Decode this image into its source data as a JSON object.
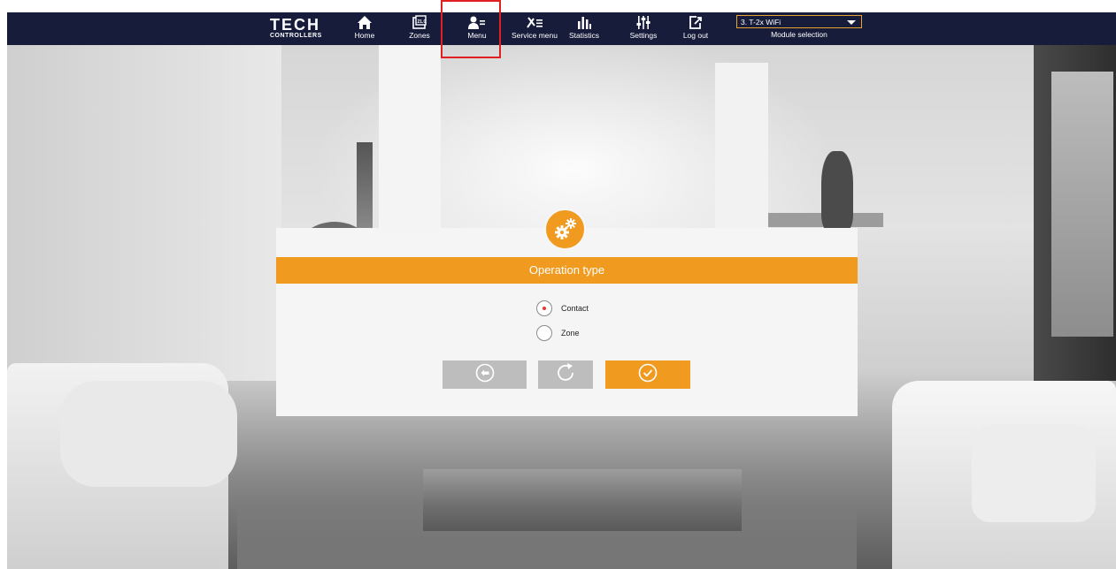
{
  "header": {
    "logo": {
      "line1": "TECH",
      "line2": "CONTROLLERS"
    },
    "nav": [
      {
        "label": "Home",
        "icon": "home-icon"
      },
      {
        "label": "Zones",
        "icon": "zones-icon"
      },
      {
        "label": "Menu",
        "icon": "menu-user-icon"
      },
      {
        "label": "Service menu",
        "icon": "service-tools-icon"
      },
      {
        "label": "Statistics",
        "icon": "statistics-bars-icon"
      },
      {
        "label": "Settings",
        "icon": "settings-sliders-icon"
      },
      {
        "label": "Log out",
        "icon": "logout-icon"
      }
    ],
    "module_select": {
      "value": "3. T-2x WiFi",
      "caption": "Module selection"
    }
  },
  "dialog": {
    "title": "Operation type",
    "icon": "gears-icon",
    "options": [
      {
        "label": "Contact",
        "selected": true
      },
      {
        "label": "Zone",
        "selected": false
      }
    ],
    "buttons": [
      {
        "name": "back",
        "icon": "back-arrow-icon"
      },
      {
        "name": "refresh",
        "icon": "refresh-icon"
      },
      {
        "name": "confirm",
        "icon": "checkmark-icon"
      }
    ]
  },
  "colors": {
    "topbar": "#171c3b",
    "accent": "#f09a1f",
    "button_grey": "#bdbdbd",
    "highlight": "#e02020"
  }
}
